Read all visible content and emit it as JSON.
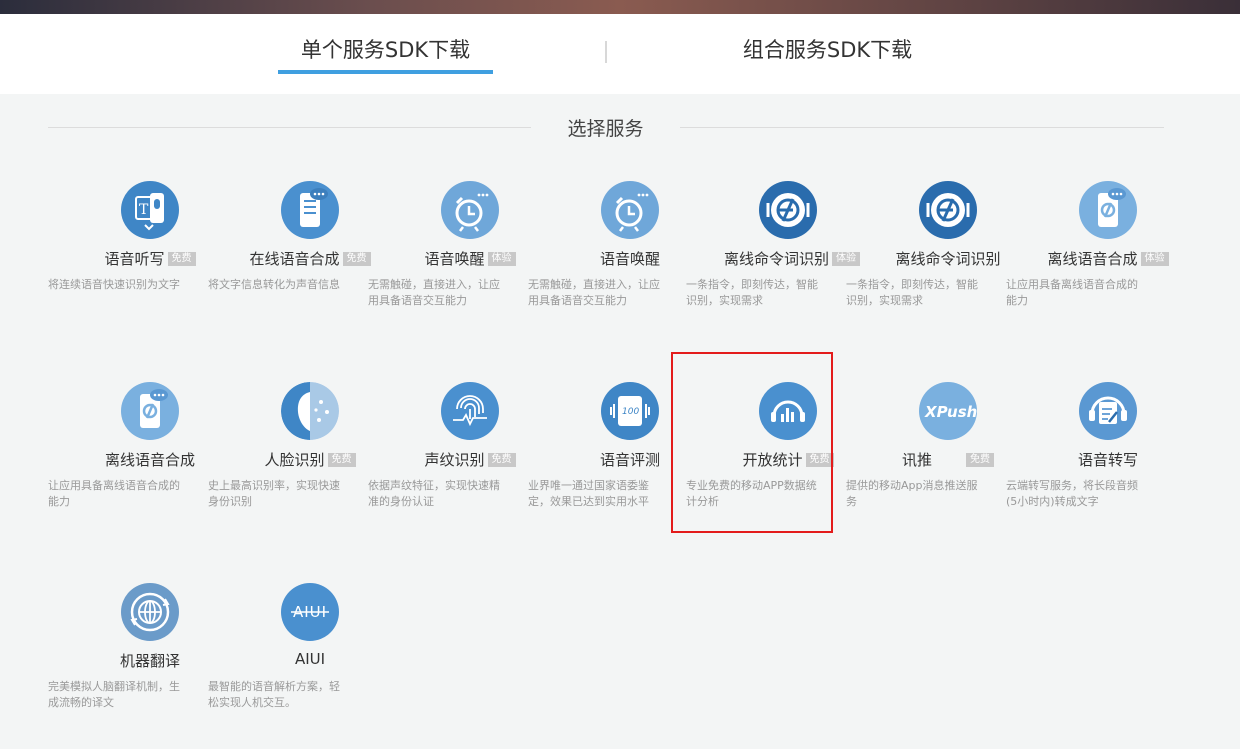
{
  "tabs": [
    {
      "label": "单个服务SDK下载",
      "active": true
    },
    {
      "label": "组合服务SDK下载",
      "active": false
    }
  ],
  "section_title": "选择服务",
  "colors": {
    "accent": "#3f9fe0",
    "icon_blue": "#4a90cf",
    "highlight": "#e31b1b",
    "badge": "#c8c8c8"
  },
  "services": [
    {
      "title": "语音听写",
      "badge": "免费",
      "desc": "将连续语音快速识别为文字",
      "icon": "speech-dictation-icon"
    },
    {
      "title": "在线语音合成",
      "badge": "免费",
      "desc": "将文字信息转化为声音信息",
      "icon": "online-tts-icon"
    },
    {
      "title": "语音唤醒",
      "badge": "体验",
      "desc": "无需触碰，直接进入，让应用具备语音交互能力",
      "icon": "alarm-clock-icon"
    },
    {
      "title": "语音唤醒",
      "badge": "",
      "desc": "无需触碰，直接进入，让应用具备语音交互能力",
      "icon": "alarm-clock-icon"
    },
    {
      "title": "离线命令词识别",
      "badge": "体验",
      "desc": "一条指令，即刻传达，智能识别，实现需求",
      "icon": "offline-command-icon"
    },
    {
      "title": "离线命令词识别",
      "badge": "",
      "desc": "一条指令，即刻传达，智能识别，实现需求",
      "icon": "offline-command-icon"
    },
    {
      "title": "离线语音合成",
      "badge": "体验",
      "desc": "让应用具备离线语音合成的能力",
      "icon": "offline-tts-icon"
    },
    {
      "title": "离线语音合成",
      "badge": "",
      "desc": "让应用具备离线语音合成的能力",
      "icon": "offline-tts-icon"
    },
    {
      "title": "人脸识别",
      "badge": "免费",
      "desc": "史上最高识别率，实现快速身份识别",
      "icon": "face-recognition-icon"
    },
    {
      "title": "声纹识别",
      "badge": "免费",
      "desc": "依据声纹特征，实现快速精准的身份认证",
      "icon": "fingerprint-icon"
    },
    {
      "title": "语音评测",
      "badge": "",
      "desc": "业界唯一通过国家语委鉴定，效果已达到实用水平",
      "icon": "speech-evaluation-icon"
    },
    {
      "title": "开放统计",
      "badge": "免费",
      "desc": "专业免费的移动APP数据统计分析",
      "icon": "open-statistics-icon"
    },
    {
      "title": "讯推",
      "badge": "免费",
      "desc": "提供的移动App消息推送服务",
      "icon": "xpush-icon"
    },
    {
      "title": "语音转写",
      "badge": "",
      "desc": "云端转写服务，将长段音频(5小时内)转成文字",
      "icon": "speech-transcription-icon"
    },
    {
      "title": "机器翻译",
      "badge": "",
      "desc": "完美模拟人脑翻译机制，生成流畅的译文",
      "icon": "machine-translation-icon"
    },
    {
      "title": "AIUI",
      "badge": "",
      "desc": "最智能的语音解析方案，轻松实现人机交互。",
      "icon": "aiui-icon"
    }
  ],
  "icon_text": {
    "xpush": "XPush",
    "aiui": "AIUI",
    "evaluation": "100"
  }
}
